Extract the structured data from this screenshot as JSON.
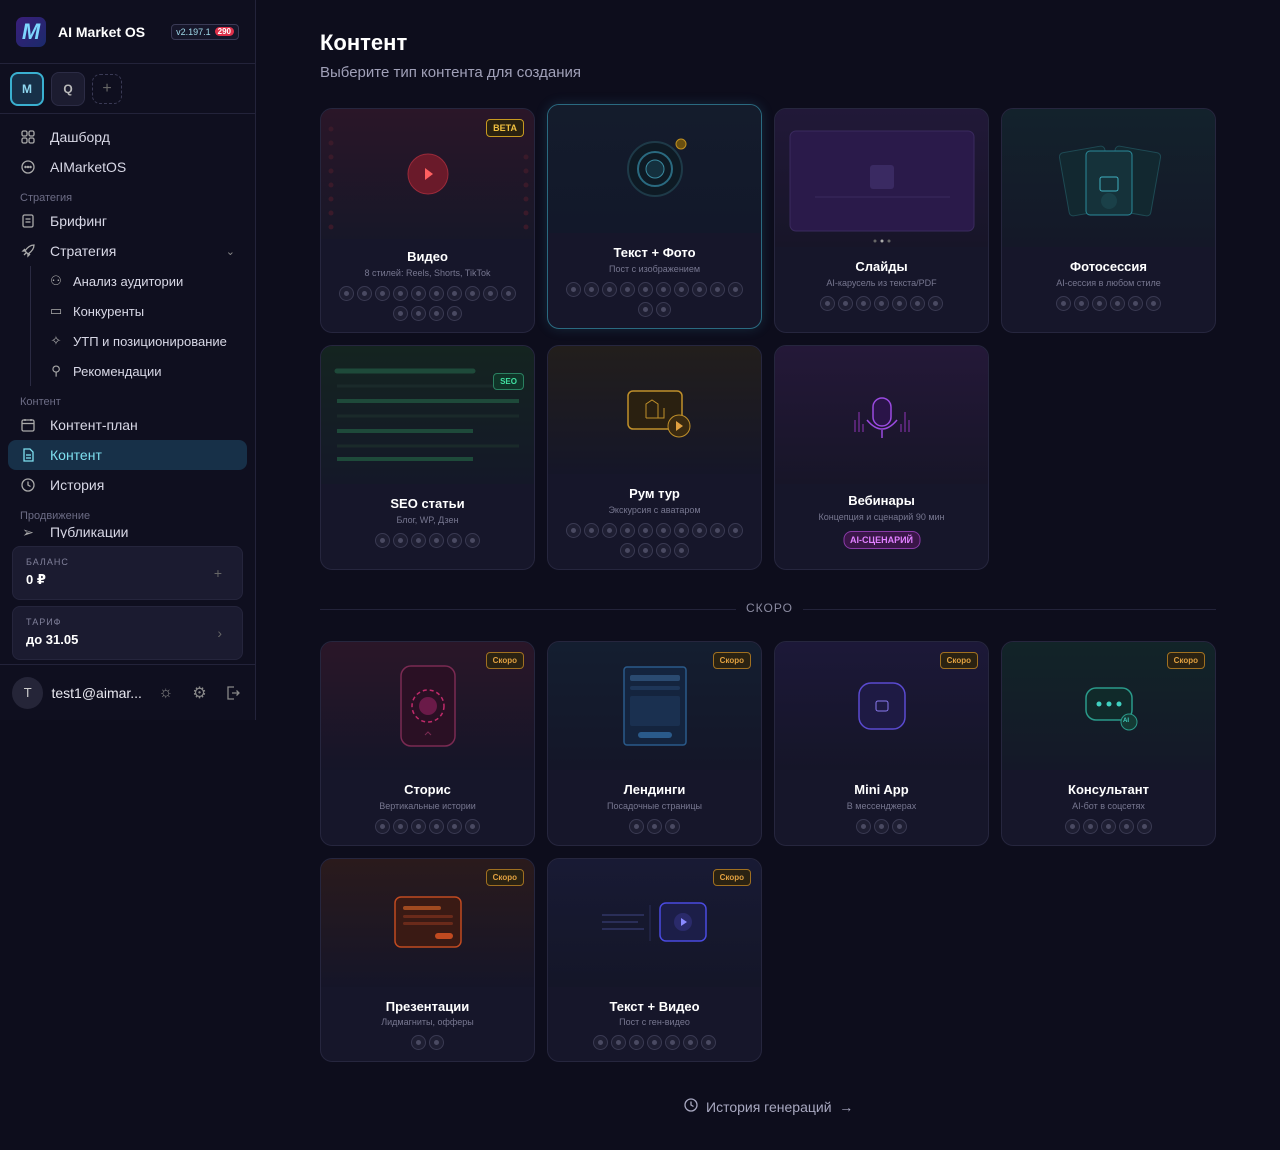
{
  "app": {
    "name": "AI Market OS",
    "version": "v2.197.1",
    "notif_count": "290"
  },
  "workspaces": [
    {
      "label": "M"
    },
    {
      "label": "Q"
    }
  ],
  "nav": {
    "dashboard": "Дашборд",
    "aimarketos": "AIMarketOS",
    "section_strategy": "Стратегия",
    "brief": "Брифинг",
    "strategy": "Стратегия",
    "audience": "Анализ аудитории",
    "competitors": "Конкуренты",
    "usp": "УТП и позиционирование",
    "recommendations": "Рекомендации",
    "section_content": "Контент",
    "content_plan": "Контент-план",
    "content": "Контент",
    "history": "История",
    "section_promo": "Продвижение",
    "publications": "Публикации"
  },
  "balance": {
    "label": "БАЛАНС",
    "value": "0 ₽"
  },
  "tariff": {
    "label": "ТАРИФ",
    "value": "до 31.05"
  },
  "user": {
    "email": "test1@aimar..."
  },
  "page": {
    "title": "Контент",
    "subtitle": "Выберите тип контента для создания"
  },
  "cards": [
    {
      "name": "Видео",
      "desc": "8 стилей: Reels, Shorts, TikTok",
      "badge": "BETA"
    },
    {
      "name": "Текст + Фото",
      "desc": "Пост с изображением"
    },
    {
      "name": "Слайды",
      "desc": "AI-карусель из текста/PDF"
    },
    {
      "name": "Фотосессия",
      "desc": "AI-сессия в любом стиле"
    },
    {
      "name": "SEO статьи",
      "desc": "Блог, WP, Дзен",
      "badge": "SEO"
    },
    {
      "name": "Рум тур",
      "desc": "Экскурсия с аватаром"
    },
    {
      "name": "Вебинары",
      "desc": "Концепция и сценарий 90 мин",
      "pill": "AI-СЦЕНАРИЙ"
    }
  ],
  "soon_label": "СКОРО",
  "soon_badge": "Скоро",
  "soon_cards": [
    {
      "name": "Сторис",
      "desc": "Вертикальные истории"
    },
    {
      "name": "Лендинги",
      "desc": "Посадочные страницы"
    },
    {
      "name": "Mini App",
      "desc": "В мессенджерах"
    },
    {
      "name": "Консультант",
      "desc": "AI-бот в соцсетях"
    },
    {
      "name": "Презентации",
      "desc": "Лидмагниты, офферы"
    },
    {
      "name": "Текст + Видео",
      "desc": "Пост с ген-видео"
    }
  ],
  "history_link": "История генераций  →",
  "ai_tag": "AI",
  "colors": {
    "accent": "#3ab0d0",
    "bg": "#0d0d1c",
    "card": "#16162a",
    "soon": "#e0a040"
  }
}
